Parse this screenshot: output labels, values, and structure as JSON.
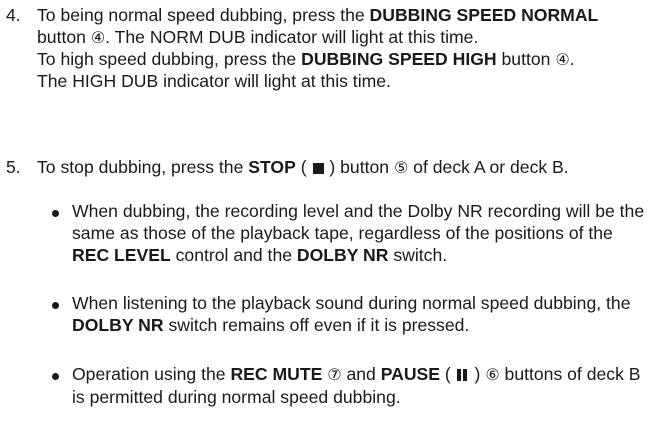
{
  "step4": {
    "number": "4.",
    "normal_pre": "To being normal speed dubbing, press the ",
    "normal_btn": "DUBBING SPEED NORMAL",
    "normal_mid": " button ",
    "normal_ref": "④",
    "normal_post": ". The NORM DUB indicator will light at this time.",
    "high_pre": "To high speed dubbing, press the ",
    "high_btn": "DUBBING SPEED HIGH",
    "high_mid": " button ",
    "high_ref": "④",
    "high_post": ".",
    "high_indicator": "The HIGH DUB indicator will light at this time."
  },
  "step5": {
    "number": "5.",
    "pre": "To stop dubbing, press the ",
    "btn": "STOP",
    "paren_open": " ( ",
    "paren_close": " ) button ",
    "ref": "⑤",
    "post": " of deck A or deck B."
  },
  "bullets": [
    {
      "t1": "When dubbing, the recording level and the Dolby NR recording will be the same as those of the playback tape, regardless of the positions of the ",
      "b1": "REC LEVEL",
      "t2": " control and the ",
      "b2": "DOLBY NR",
      "t3": " switch."
    },
    {
      "t1": "When listening to the playback sound during normal speed dubbing, the ",
      "b1": "DOLBY NR",
      "t2": " switch remains off even if it is pressed."
    },
    {
      "t1": "Operation using the ",
      "b1": "REC MUTE",
      "ref1": "⑦",
      "t2": " and ",
      "b2": "PAUSE",
      "paren_open": " ( ",
      "paren_close": " ) ",
      "ref2": "⑥",
      "t3": " buttons of deck B is permitted during normal speed dubbing."
    }
  ],
  "icons": {
    "stop": "stop-square-icon",
    "pause": "pause-bars-icon"
  }
}
